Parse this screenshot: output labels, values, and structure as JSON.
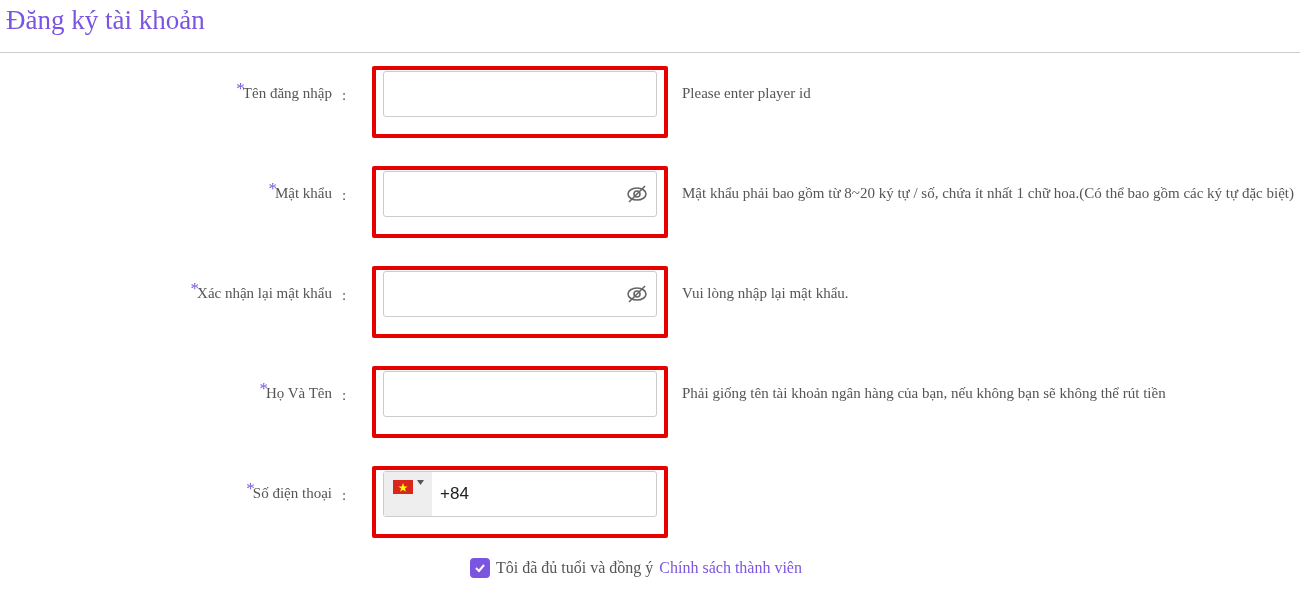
{
  "title": "Đăng ký tài khoản",
  "fields": [
    {
      "kind": "text",
      "label": "Tên đăng nhập",
      "required_mark": "*",
      "separator": ":",
      "hint": "Please enter player id"
    },
    {
      "kind": "password",
      "label": "Mật khẩu",
      "required_mark": "*",
      "separator": ":",
      "hint": "Mật khẩu phải bao gồm từ 8~20 ký tự / số, chứa ít nhất 1 chữ hoa.(Có thể bao gồm các ký tự đặc biệt)"
    },
    {
      "kind": "password",
      "label": "Xác nhận lại mật khẩu",
      "required_mark": "*",
      "separator": ":",
      "hint": "Vui lòng nhập lại mật khẩu."
    },
    {
      "kind": "text",
      "label": "Họ Và Tên",
      "required_mark": "*",
      "separator": ":",
      "hint": "Phải giống tên tài khoản ngân hàng của bạn, nếu không bạn sẽ không thể rút tiền"
    },
    {
      "kind": "phone",
      "label": "Số điện thoại",
      "required_mark": "*",
      "separator": ":",
      "value": "+84"
    }
  ],
  "agreement": {
    "checked": true,
    "text": "Tôi đã đủ tuổi và đồng ý",
    "link": "Chính sách thành viên"
  }
}
